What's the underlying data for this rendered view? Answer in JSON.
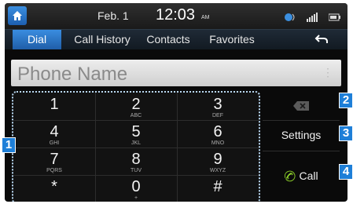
{
  "status": {
    "date": "Feb.  1",
    "time": "12:03",
    "ampm": "AM"
  },
  "tabs": [
    {
      "label": "Dial"
    },
    {
      "label": "Call History"
    },
    {
      "label": "Contacts"
    },
    {
      "label": "Favorites"
    }
  ],
  "phone_name": {
    "placeholder": "Phone Name"
  },
  "keypad": [
    {
      "digit": "1",
      "sub": ""
    },
    {
      "digit": "2",
      "sub": "ABC"
    },
    {
      "digit": "3",
      "sub": "DEF"
    },
    {
      "digit": "4",
      "sub": "GHI"
    },
    {
      "digit": "5",
      "sub": "JKL"
    },
    {
      "digit": "6",
      "sub": "MNO"
    },
    {
      "digit": "7",
      "sub": "PQRS"
    },
    {
      "digit": "8",
      "sub": "TUV"
    },
    {
      "digit": "9",
      "sub": "WXYZ"
    },
    {
      "digit": "*",
      "sub": ""
    },
    {
      "digit": "0",
      "sub": "+"
    },
    {
      "digit": "#",
      "sub": ""
    }
  ],
  "side": {
    "settings_label": "Settings",
    "call_label": "Call"
  },
  "callouts": [
    "1",
    "2",
    "3",
    "4"
  ],
  "colors": {
    "accent": "#1e7fd8",
    "call_green": "#8fd42a"
  }
}
